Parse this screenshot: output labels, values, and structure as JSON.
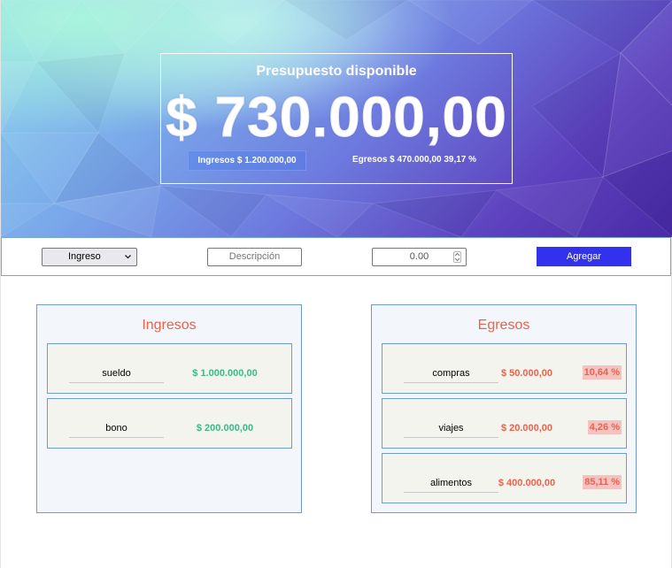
{
  "hero": {
    "title": "Presupuesto disponible",
    "available": "$ 730.000,00",
    "income_summary": "Ingresos $ 1.200.000,00",
    "expense_summary": "Egresos $ 470.000,00 39,17 %"
  },
  "form": {
    "type_selected": "Ingreso",
    "description_placeholder": "Descripción",
    "amount_placeholder": "0.00",
    "add_label": "Agregar"
  },
  "income_panel": {
    "title": "Ingresos",
    "items": [
      {
        "description": "sueldo",
        "value": "$ 1.000.000,00"
      },
      {
        "description": "bono",
        "value": "$ 200.000,00"
      }
    ]
  },
  "expense_panel": {
    "title": "Egresos",
    "items": [
      {
        "description": "compras",
        "value": "$ 50.000,00",
        "percent": "10,64 %"
      },
      {
        "description": "viajes",
        "value": "$ 20.000,00",
        "percent": "4,26 %"
      },
      {
        "description": "alimentos",
        "value": "$ 400.000,00",
        "percent": "85,11 %"
      }
    ]
  },
  "colors": {
    "accent": "#3131ee",
    "expense": "#e7634b",
    "income": "#3bb88b",
    "panel_border": "#6f9cce"
  }
}
